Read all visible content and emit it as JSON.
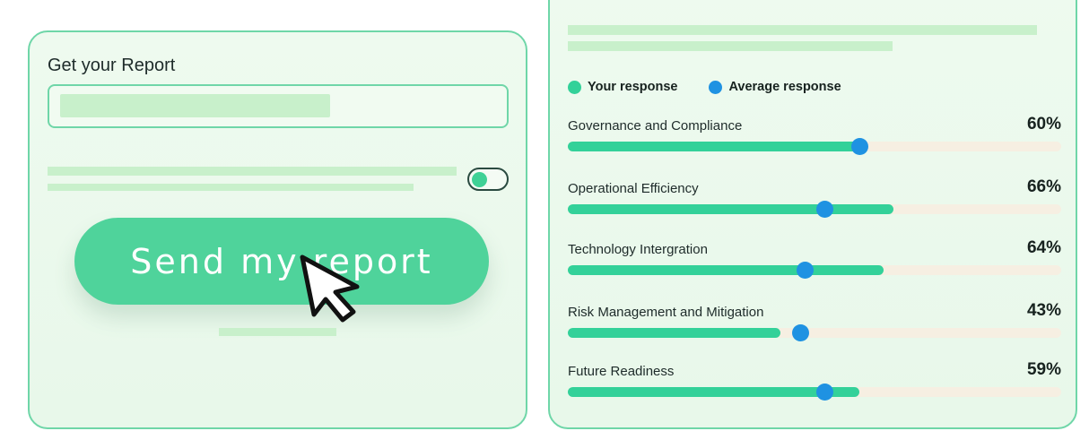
{
  "report_form": {
    "title": "Get your Report",
    "send_button_label": "Send my report",
    "toggle_on": true
  },
  "legend": {
    "your_label": "Your response",
    "average_label": "Average response",
    "your_color": "#33d199",
    "average_color": "#1f92e2"
  },
  "chart_data": {
    "type": "bar",
    "categories": [
      "Governance and Compliance",
      "Operational Efficiency",
      "Technology Intergration",
      "Risk Management and Mitigation",
      "Future Readiness"
    ],
    "series": [
      {
        "name": "Your response",
        "values": [
          60,
          66,
          64,
          43,
          59
        ]
      },
      {
        "name": "Average response",
        "values": [
          59,
          52,
          48,
          47,
          52
        ]
      }
    ],
    "value_labels": [
      "60%",
      "66%",
      "64%",
      "43%",
      "59%"
    ],
    "ylim": [
      0,
      100
    ]
  },
  "icons": {
    "cursor": "arrow-cursor-icon"
  }
}
